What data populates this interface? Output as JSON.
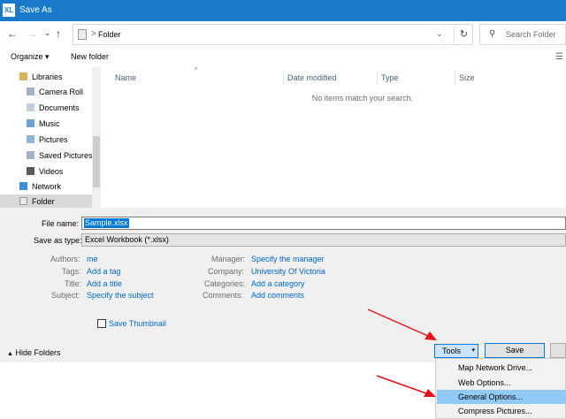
{
  "window": {
    "title": "Save As",
    "app_icon": "XL"
  },
  "address_bar": {
    "back_glyph": "←",
    "forward_glyph": "→",
    "recent_glyph": "⌄",
    "up_glyph": "↑",
    "crumb_separator": ">",
    "breadcrumb": "Folder",
    "dropdown_glyph": "⌄",
    "refresh_glyph": "↻",
    "search_glyph": "⚲",
    "search_placeholder": "Search Folder"
  },
  "toolbar": {
    "organize_label": "Organize ▾",
    "new_folder_label": "New folder",
    "view_glyph": "☰"
  },
  "nav": {
    "items": [
      {
        "label": "Libraries",
        "icon": "libraries-icon"
      },
      {
        "label": "Camera Roll",
        "icon": "camera-roll-icon"
      },
      {
        "label": "Documents",
        "icon": "documents-icon"
      },
      {
        "label": "Music",
        "icon": "music-icon"
      },
      {
        "label": "Pictures",
        "icon": "pictures-icon"
      },
      {
        "label": "Saved Pictures",
        "icon": "saved-pictures-icon"
      },
      {
        "label": "Videos",
        "icon": "videos-icon"
      },
      {
        "label": "Network",
        "icon": "network-icon"
      },
      {
        "label": "Folder",
        "icon": "folder-icon"
      }
    ]
  },
  "content": {
    "sort_caret": "^",
    "columns": [
      "Name",
      "Date modified",
      "Type",
      "Size"
    ],
    "empty_message": "No items match your search."
  },
  "form": {
    "file_name_label": "File name:",
    "file_name_value": "Sample.xlsx",
    "save_type_label": "Save as type:",
    "save_type_value": "Excel Workbook (*.xlsx)",
    "authors_label": "Authors:",
    "authors_value": "me",
    "tags_label": "Tags:",
    "tags_value": "Add a tag",
    "title_label": "Title:",
    "title_value": "Add a title",
    "subject_label": "Subject:",
    "subject_value": "Specify the subject",
    "manager_label": "Manager:",
    "manager_value": "Specify the manager",
    "company_label": "Company:",
    "company_value": "University Of Victoria",
    "categories_label": "Categories:",
    "categories_value": "Add a category",
    "comments_label": "Comments:",
    "comments_value": "Add comments",
    "thumbnail_label": "Save Thumbnail"
  },
  "footer": {
    "hide_folders_label": "Hide Folders",
    "tools_label": "Tools",
    "tools_arrow": "▾",
    "save_label": "Save"
  },
  "tools_menu": {
    "items": [
      "Map Network Drive...",
      "Web Options...",
      "General Options...",
      "Compress Pictures..."
    ],
    "highlighted": "General Options..."
  },
  "colors": {
    "titlebar": "#1979ca",
    "accent": "#0078d7",
    "link": "#0066cc",
    "annotation_arrow": "#e8101a",
    "menu_highlight": "#91c9f7"
  }
}
